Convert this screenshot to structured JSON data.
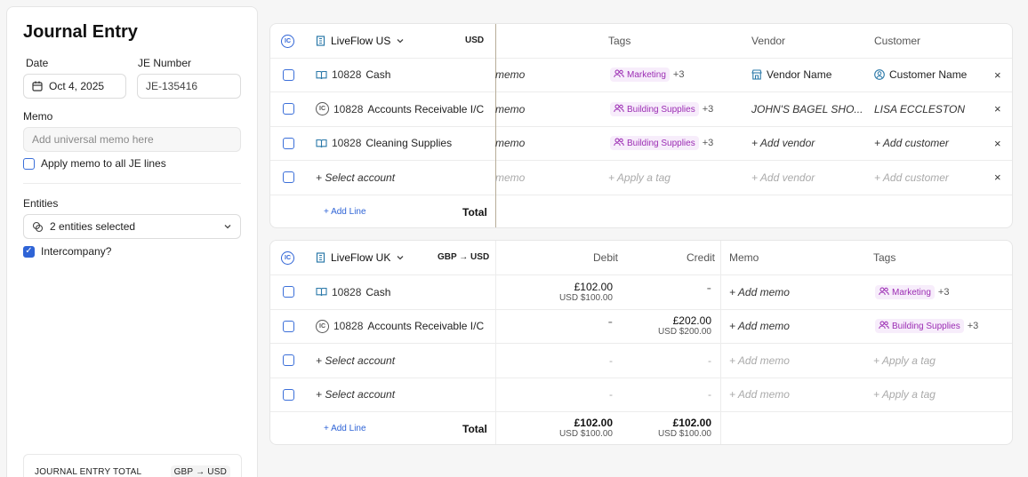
{
  "left": {
    "title": "Journal Entry",
    "date_label": "Date",
    "date_value": "Oct 4, 2025",
    "je_label": "JE Number",
    "je_value": "JE-135416",
    "memo_label": "Memo",
    "memo_placeholder": "Add universal memo here",
    "apply_memo_label": "Apply memo to all JE lines",
    "entities_label": "Entities",
    "entities_value": "2 entities selected",
    "intercompany_label": "Intercompany?",
    "intercompany_checked": true,
    "total_label": "JOURNAL ENTRY TOTAL",
    "total_currency": "GBP → USD"
  },
  "us": {
    "entity": "LiveFlow US",
    "currency": "USD",
    "headers": {
      "tags": "Tags",
      "vendor": "Vendor",
      "customer": "Customer"
    },
    "rows": [
      {
        "account_num": "10828",
        "account": "Cash",
        "memo": "memo",
        "tag": "Marketing",
        "tag_more": "+3",
        "vendor": "Vendor Name",
        "customer": "Customer Name"
      },
      {
        "account_num": "10828",
        "account": "Accounts Receivable I/C",
        "memo": "memo",
        "tag": "Building Supplies",
        "tag_more": "+3",
        "vendor": "JOHN'S BAGEL SHO...",
        "customer": "LISA ECCLESTON"
      },
      {
        "account_num": "10828",
        "account": "Cleaning Supplies",
        "memo": "memo",
        "tag": "Building Supplies",
        "tag_more": "+3",
        "vendor": "+ Add vendor",
        "customer": "+ Add customer"
      },
      {
        "account": "+ Select account",
        "memo": "memo",
        "tag": "+ Apply a tag",
        "vendor": "+ Add vendor",
        "customer": "+ Add customer"
      }
    ],
    "add_line": "+ Add Line",
    "total_label": "Total"
  },
  "uk": {
    "entity": "LiveFlow UK",
    "currency": "GBP → USD",
    "headers": {
      "debit": "Debit",
      "credit": "Credit",
      "memo": "Memo",
      "tags": "Tags"
    },
    "rows": [
      {
        "account_num": "10828",
        "account": "Cash",
        "debit": "£102.00",
        "debit_usd": "USD $100.00",
        "credit": "-",
        "memo": "+ Add memo",
        "tag": "Marketing",
        "tag_more": "+3"
      },
      {
        "account_num": "10828",
        "account": "Accounts Receivable I/C",
        "debit": "-",
        "credit": "£202.00",
        "credit_usd": "USD $200.00",
        "memo": "+ Add memo",
        "tag": "Building Supplies",
        "tag_more": "+3"
      },
      {
        "account": "+ Select account",
        "debit": "-",
        "credit": "-",
        "memo": "+ Add memo",
        "tag": "+ Apply a tag"
      },
      {
        "account": "+ Select account",
        "debit": "-",
        "credit": "-",
        "memo": "+ Add memo",
        "tag": "+ Apply a tag"
      }
    ],
    "add_line": "+ Add Line",
    "total_label": "Total",
    "total_debit": "£102.00",
    "total_debit_usd": "USD $100.00",
    "total_credit": "£102.00",
    "total_credit_usd": "USD $100.00"
  },
  "icons": {
    "ic": "IC",
    "arrow": "→",
    "close": "×"
  },
  "colors": {
    "accent": "#2f64d6",
    "tag_bg": "#f7edfb",
    "tag_text": "#9b2cb3"
  }
}
